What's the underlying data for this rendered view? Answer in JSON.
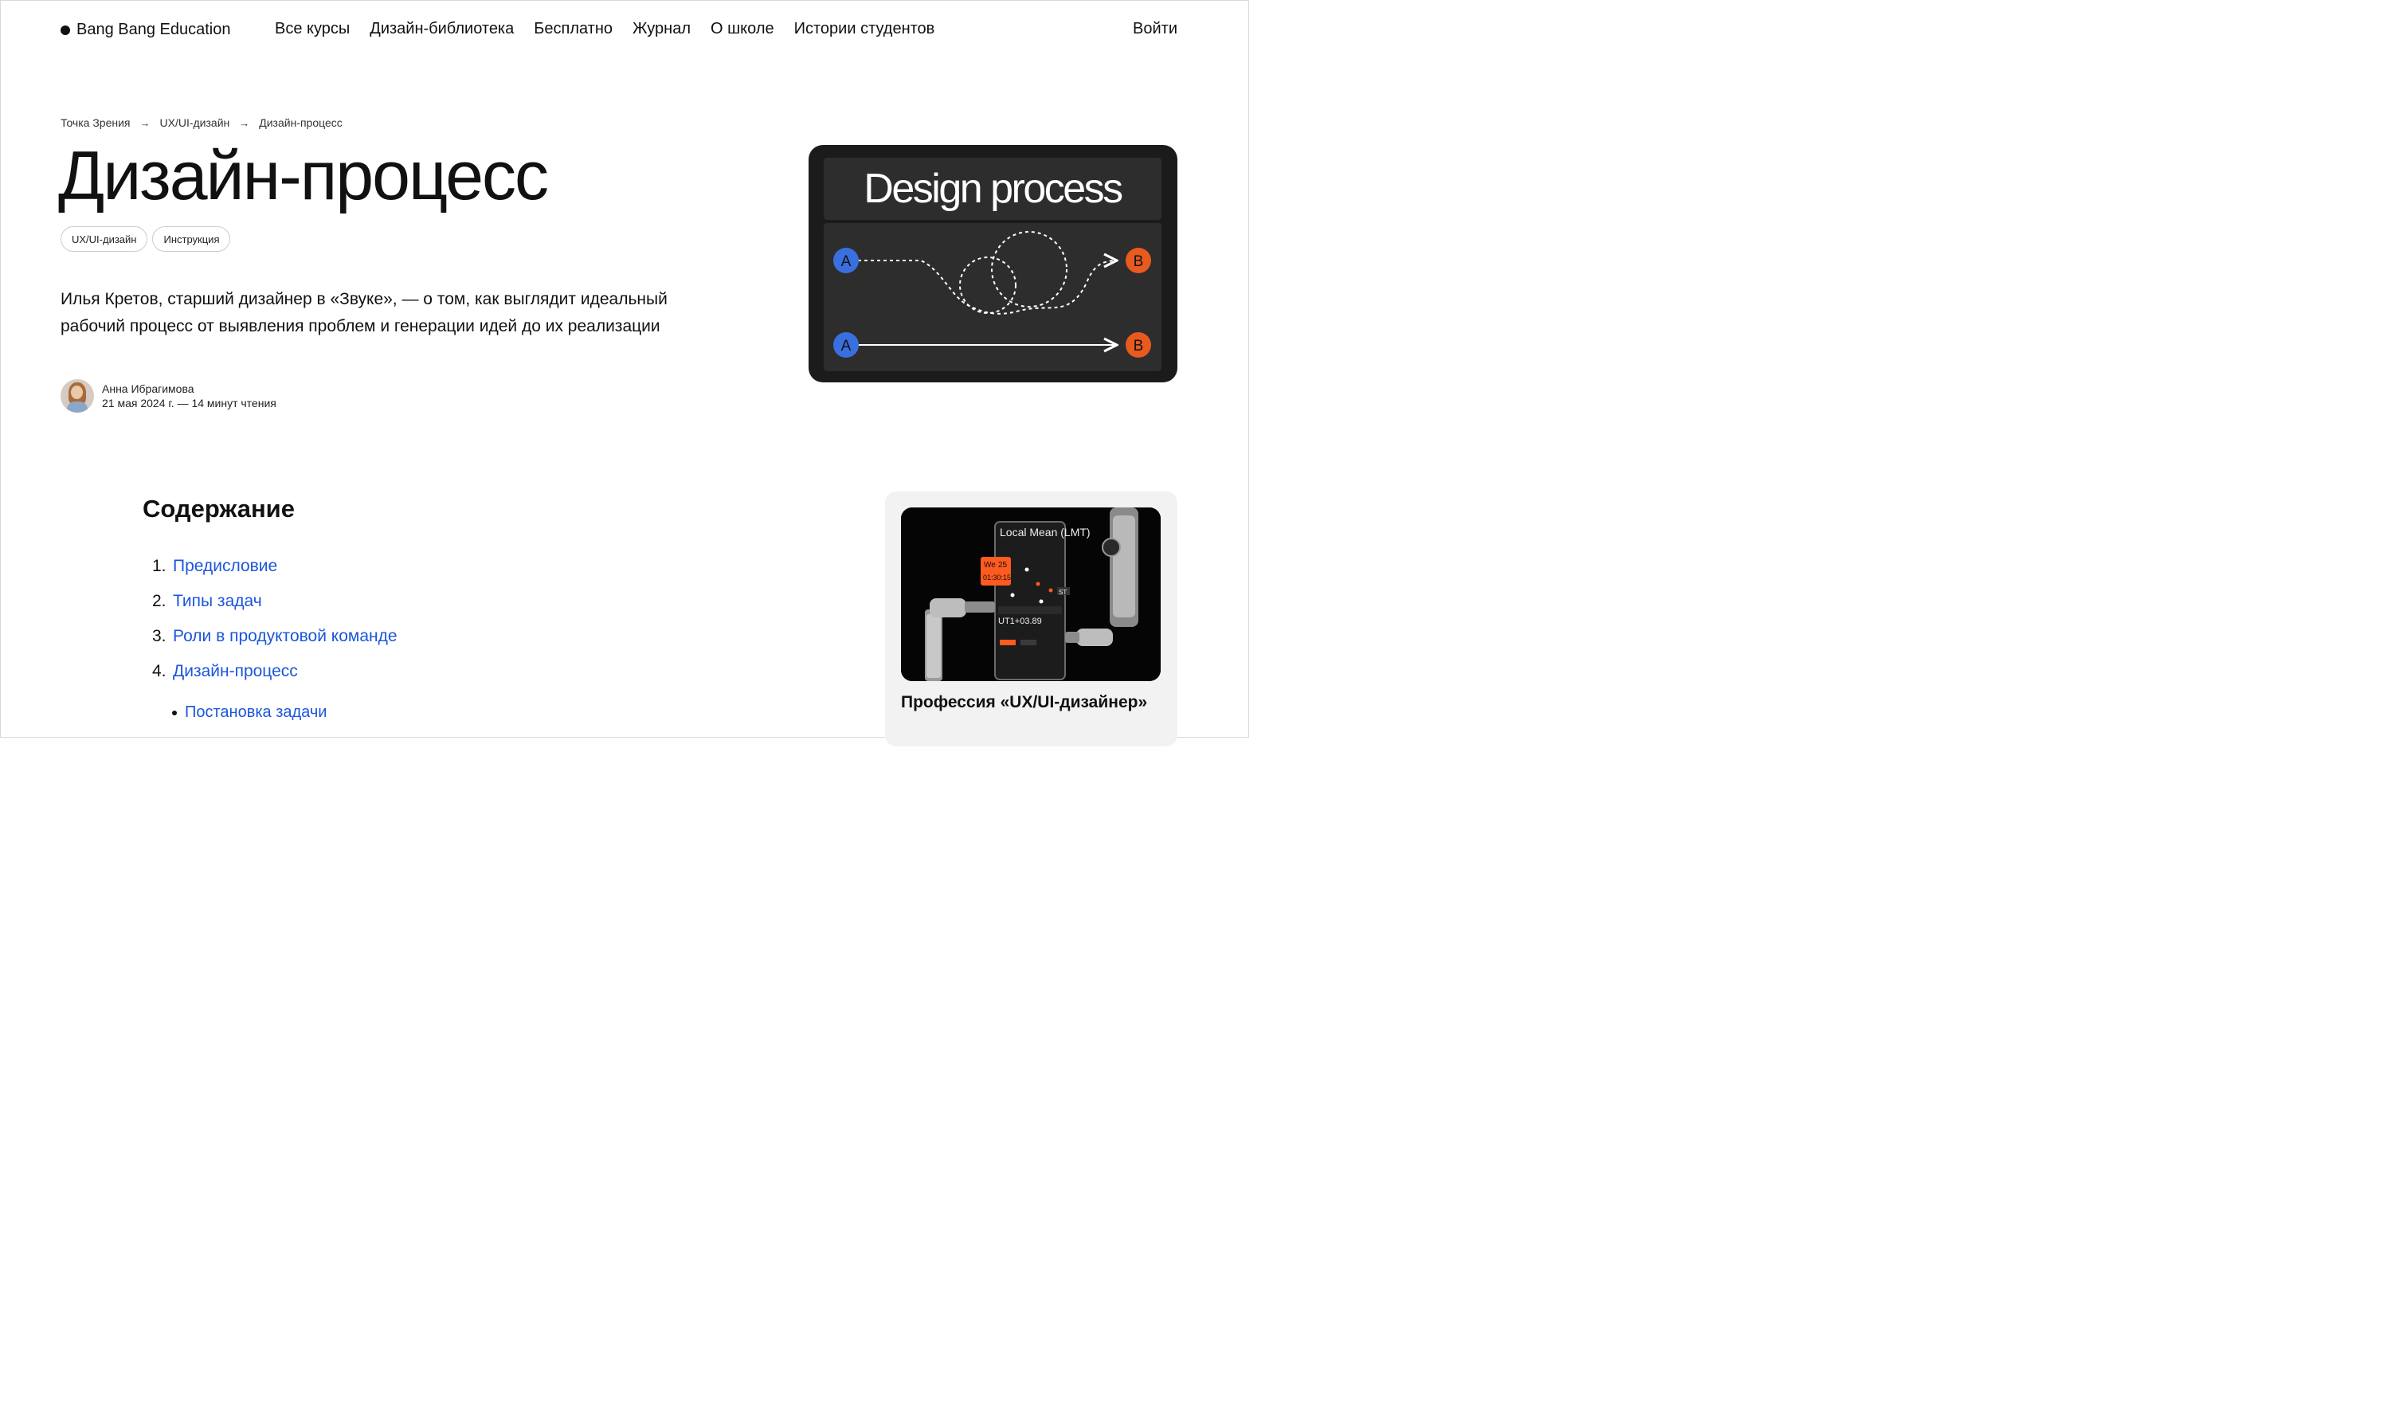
{
  "header": {
    "logo": "Bang Bang Education",
    "nav": [
      "Все курсы",
      "Дизайн-библиотека",
      "Бесплатно",
      "Журнал",
      "О школе",
      "Истории студентов"
    ],
    "login": "Войти"
  },
  "breadcrumbs": [
    "Точка Зрения",
    "UX/UI-дизайн",
    "Дизайн-процесс"
  ],
  "title": "Дизайн-процесс",
  "tags": [
    "UX/UI-дизайн",
    "Инструкция"
  ],
  "lead": "Илья Кретов, старший дизайнер в «Звуке», — о том, как выглядит идеальный рабочий процесс от выявления проблем и генерации идей до их реализации",
  "author": {
    "name": "Анна Ибрагимова",
    "meta": "21 мая 2024 г. — 14 минут чтения"
  },
  "hero": {
    "title": "Design process",
    "point_a": "A",
    "point_b": "B",
    "colors": {
      "a": "#3a6fe0",
      "b": "#e85a1e"
    }
  },
  "contents": {
    "heading": "Содержание",
    "items": [
      {
        "num": "1.",
        "label": "Предисловие"
      },
      {
        "num": "2.",
        "label": "Типы задач"
      },
      {
        "num": "3.",
        "label": "Роли в продуктовой команде"
      },
      {
        "num": "4.",
        "label": "Дизайн-процесс"
      }
    ],
    "sub_item": "Постановка задачи"
  },
  "promo": {
    "title": "Профессия «UX/UI-дизайнер»",
    "screen": {
      "heading": "Local Mean (LMT)",
      "badge_day": "We",
      "badge_num": "25",
      "timer": "01:30:15",
      "offset": "UT1+03.89",
      "tag": "ST"
    }
  },
  "accent_link_color": "#1a56db"
}
